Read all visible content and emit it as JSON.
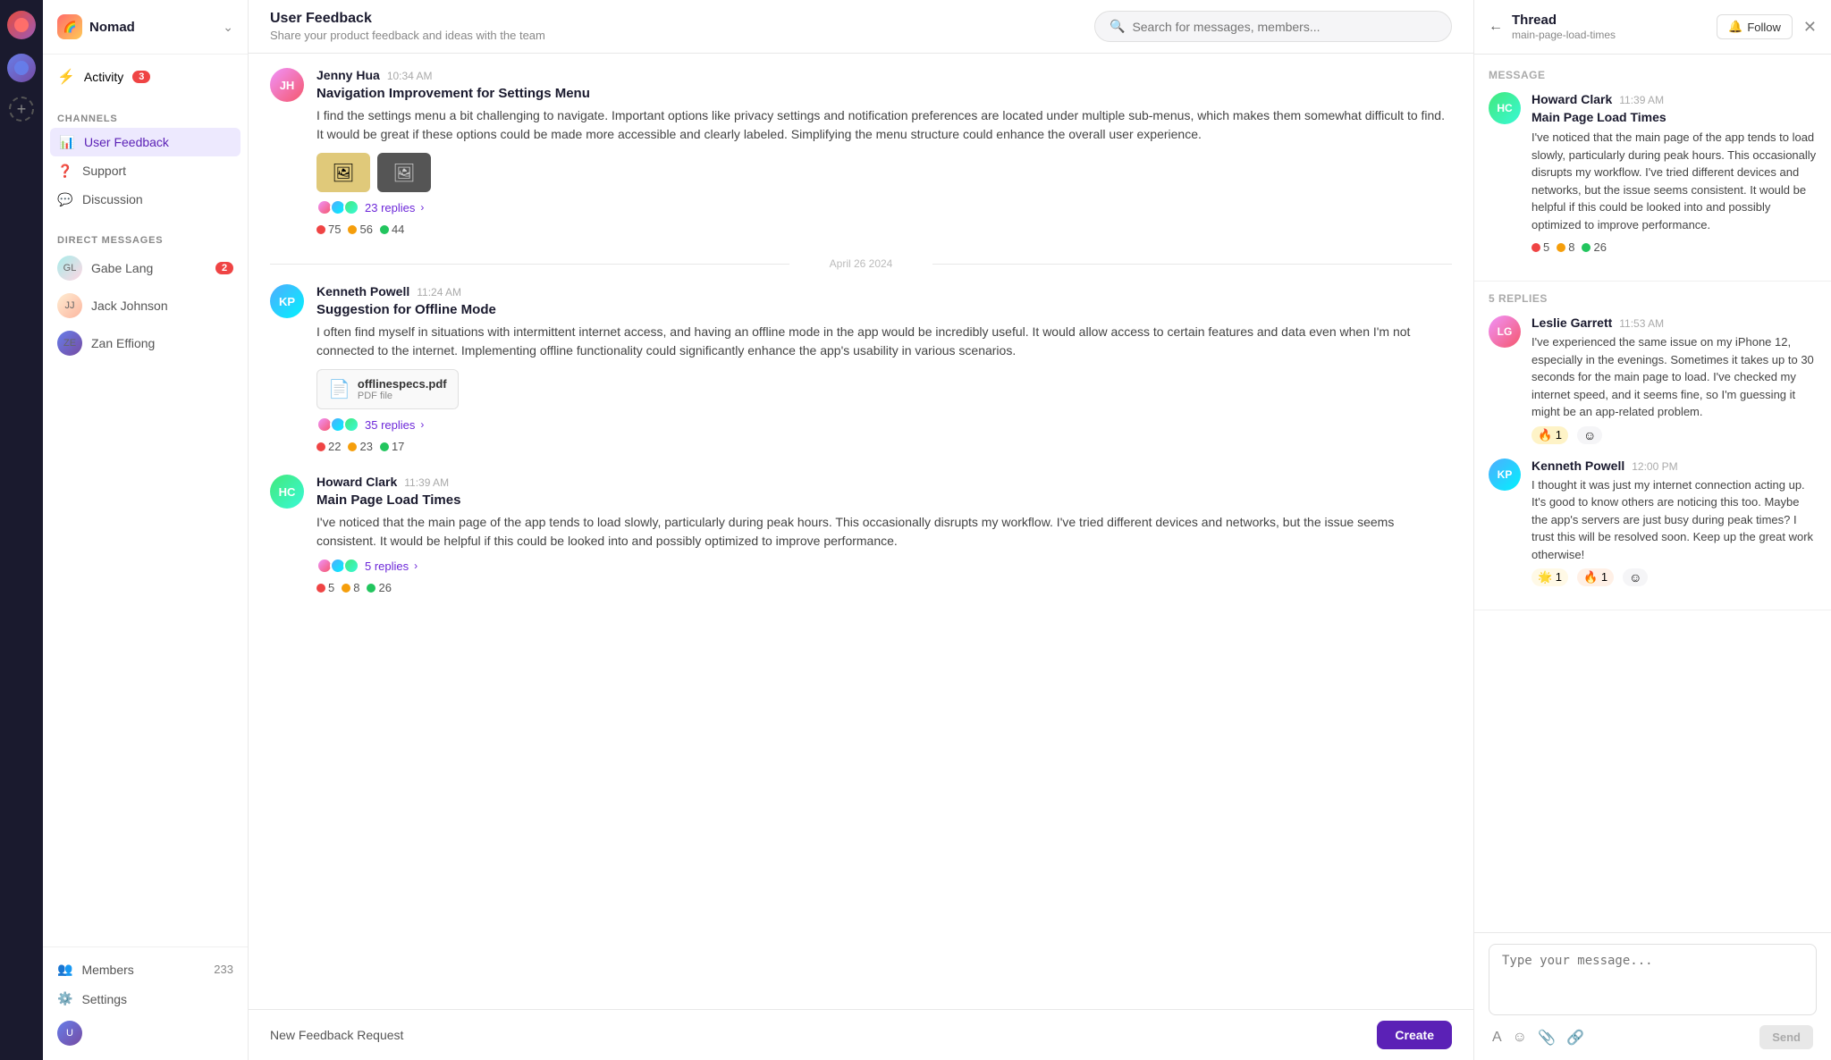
{
  "app": {
    "name": "Nomad",
    "logo_emoji": "🌈"
  },
  "sidebar": {
    "workspace": "Nomad",
    "activity_label": "Activity",
    "activity_badge": "3",
    "channels_label": "CHANNELS",
    "channels": [
      {
        "id": "user-feedback",
        "label": "User Feedback",
        "icon": "chart",
        "active": true
      },
      {
        "id": "support",
        "label": "Support",
        "icon": "help"
      },
      {
        "id": "discussion",
        "label": "Discussion",
        "icon": "chat"
      }
    ],
    "dm_label": "DIRECT MESSAGES",
    "dms": [
      {
        "id": "gabe-lang",
        "label": "Gabe Lang",
        "badge": "2"
      },
      {
        "id": "jack-johnson",
        "label": "Jack Johnson",
        "badge": ""
      },
      {
        "id": "zan-effiong",
        "label": "Zan Effiong",
        "badge": ""
      }
    ],
    "members_label": "Members",
    "members_count": "233",
    "settings_label": "Settings"
  },
  "channel": {
    "name": "User Feedback",
    "description": "Share your product feedback and ideas with the team"
  },
  "search": {
    "placeholder": "Search for messages, members..."
  },
  "messages": [
    {
      "id": "msg1",
      "author": "Jenny Hua",
      "time": "10:34 AM",
      "title": "Navigation Improvement for Settings Menu",
      "text": "I find the settings menu a bit challenging to navigate. Important options like privacy settings and notification preferences are located under multiple sub-menus, which makes them somewhat difficult to find. It would be great if these options could be made more accessible and clearly labeled. Simplifying the menu structure could enhance the overall user experience.",
      "has_images": true,
      "replies_count": "23 replies",
      "reactions": [
        {
          "color": "red",
          "count": "75"
        },
        {
          "color": "yellow",
          "count": "56"
        },
        {
          "color": "green",
          "count": "44"
        }
      ]
    },
    {
      "id": "msg2",
      "author": "Kenneth Powell",
      "time": "11:24 AM",
      "title": "Suggestion for Offline Mode",
      "text": "I often find myself in situations with intermittent internet access, and having an offline mode in the app would be incredibly useful. It would allow access to certain features and data even when I'm not connected to the internet. Implementing offline functionality could significantly enhance the app's usability in various scenarios.",
      "has_file": true,
      "file_name": "offlinespecs.pdf",
      "file_type": "PDF file",
      "replies_count": "35 replies",
      "reactions": [
        {
          "color": "red",
          "count": "22"
        },
        {
          "color": "yellow",
          "count": "23"
        },
        {
          "color": "green",
          "count": "17"
        }
      ]
    },
    {
      "id": "msg3",
      "author": "Howard Clark",
      "time": "11:39 AM",
      "title": "Main Page Load Times",
      "text": "I've noticed that the main page of the app tends to load slowly, particularly during peak hours. This occasionally disrupts my workflow. I've tried different devices and networks, but the issue seems consistent. It would be helpful if this could be looked into and possibly optimized to improve performance.",
      "replies_count": "5 replies",
      "reactions": [
        {
          "color": "red",
          "count": "5"
        },
        {
          "color": "yellow",
          "count": "8"
        },
        {
          "color": "green",
          "count": "26"
        }
      ]
    }
  ],
  "date_divider": "April 26 2024",
  "bottom_bar": {
    "label": "New Feedback Request",
    "button": "Create"
  },
  "thread": {
    "title": "Thread",
    "subtitle": "main-page-load-times",
    "follow_label": "Follow",
    "message_label": "MESSAGE",
    "author": "Howard Clark",
    "time": "11:39 AM",
    "title_msg": "Main Page Load Times",
    "text": "I've noticed that the main page of the app tends to load slowly, particularly during peak hours. This occasionally disrupts my workflow. I've tried different devices and networks, but the issue seems consistent. It would be helpful if this could be looked into and possibly optimized to improve performance.",
    "reactions": [
      {
        "emoji": "🔴",
        "count": "5"
      },
      {
        "emoji": "🟡",
        "count": "8"
      },
      {
        "emoji": "🟢",
        "count": "26"
      }
    ],
    "replies_label": "5 REPLIES",
    "replies": [
      {
        "author": "Leslie Garrett",
        "time": "11:53 AM",
        "text": "I've experienced the same issue on my iPhone 12, especially in the evenings. Sometimes it takes up to 30 seconds for the main page to load. I've checked my internet speed, and it seems fine, so I'm guessing it might be an app-related problem.",
        "emoji_reaction": "🔥",
        "emoji_count": "1"
      },
      {
        "author": "Kenneth Powell",
        "time": "12:00 PM",
        "text": "I thought it was just my internet connection acting up. It's good to know others are noticing this too. Maybe the app's servers are just busy during peak times? I trust this will be resolved soon. Keep up the great work otherwise!",
        "emoji1": "🌟",
        "emoji1_count": "1",
        "emoji2": "🔥",
        "emoji2_count": "1"
      }
    ],
    "input_placeholder": "Type your message...",
    "send_label": "Send"
  }
}
